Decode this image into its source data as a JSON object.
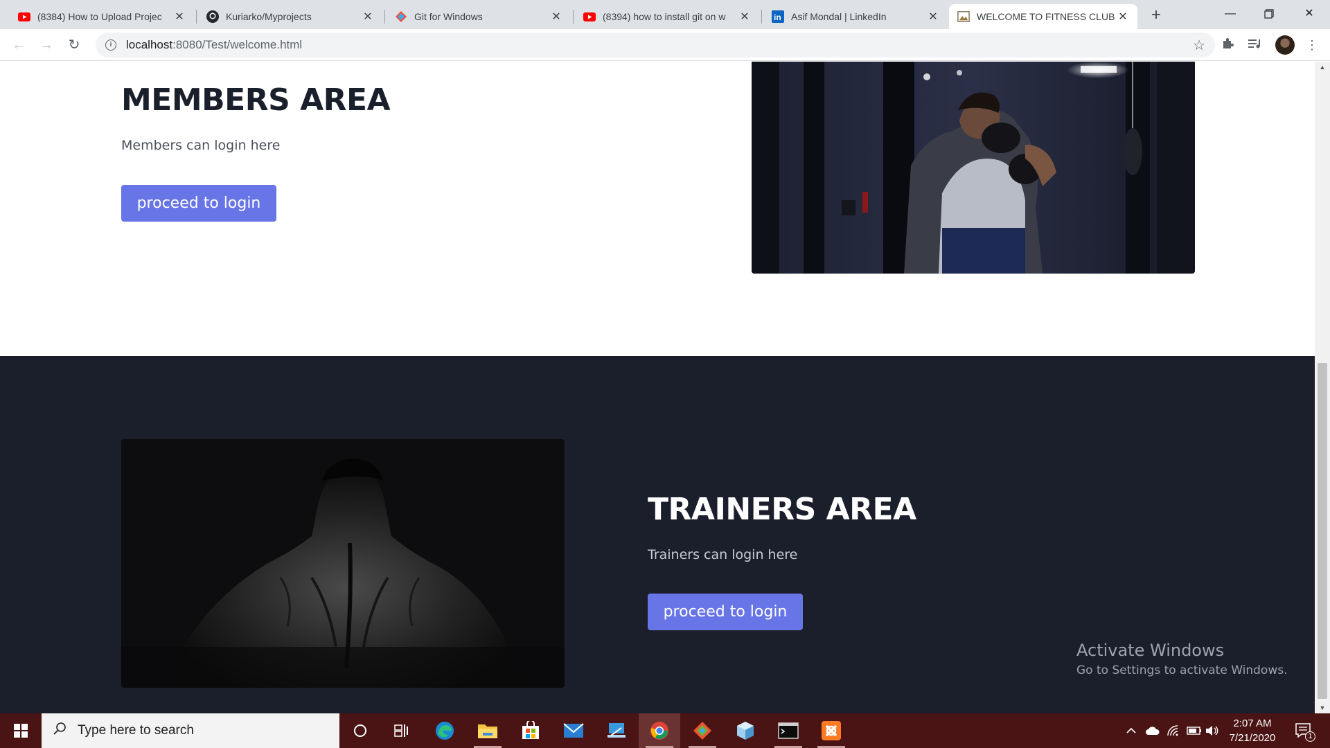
{
  "browser": {
    "tabs": [
      {
        "title": "(8384) How to Upload Projec",
        "favicon": "youtube-icon"
      },
      {
        "title": "Kuriarko/Myprojects",
        "favicon": "github-icon"
      },
      {
        "title": "Git for Windows",
        "favicon": "git-icon"
      },
      {
        "title": "(8394) how to install git on w",
        "favicon": "youtube-icon"
      },
      {
        "title": "Asif Mondal | LinkedIn",
        "favicon": "linkedin-icon"
      },
      {
        "title": "WELCOME TO FITNESS CLUB",
        "favicon": "page-image-icon",
        "active": true
      }
    ],
    "new_tab": "+",
    "url_host": "localhost",
    "url_rest": ":8080/Test/welcome.html"
  },
  "members": {
    "heading": "MEMBERS AREA",
    "description": "Members can login here",
    "button": "proceed to login",
    "image": "boxer-training-photo"
  },
  "trainers": {
    "heading": "TRAINERS AREA",
    "description": "Trainers can login here",
    "button": "proceed to login",
    "image": "muscular-back-photo"
  },
  "watermark": {
    "title": "Activate Windows",
    "subtitle": "Go to Settings to activate Windows."
  },
  "taskbar": {
    "search_placeholder": "Type here to search",
    "time": "2:07 AM",
    "date": "7/21/2020",
    "notification_count": "1",
    "apps": [
      "cortana-icon",
      "task-view-icon",
      "edge-icon",
      "file-explorer-icon",
      "store-icon",
      "mail-icon",
      "remote-desktop-icon",
      "chrome-icon",
      "git-icon",
      "virtualbox-icon",
      "terminal-icon",
      "xampp-icon"
    ]
  },
  "colors": {
    "accent": "#6875e6",
    "dark_section": "#1b1f2b",
    "taskbar": "#4a1414"
  }
}
